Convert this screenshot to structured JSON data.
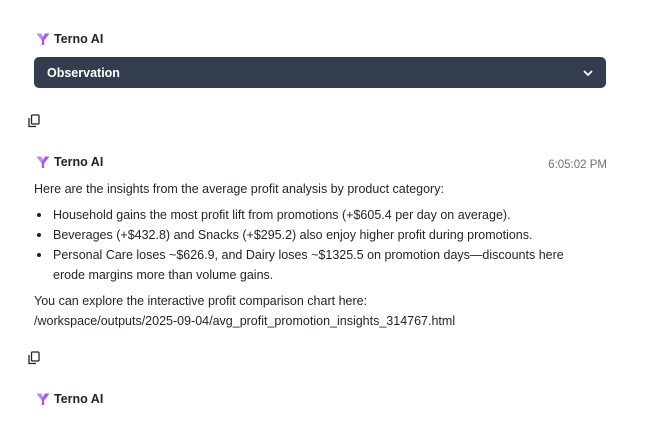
{
  "agent": {
    "name": "Terno AI",
    "logo_icon": "terno-logo-icon",
    "logo_color": "#a855f7"
  },
  "observation": {
    "label": "Observation",
    "icon": "chevron-down-icon"
  },
  "message": {
    "timestamp": "6:05:02 PM",
    "intro": "Here are the insights from the average profit analysis by product category:",
    "bullets": [
      {
        "line1": "Household gains the most profit lift from promotions (+$605.4 per day on average).",
        "line2": ""
      },
      {
        "line1": "Beverages (+$432.8) and Snacks (+$295.2) also enjoy higher profit during promotions.",
        "line2": ""
      },
      {
        "line1": "Personal Care loses ~$626.9, and Dairy loses ~$1325.5 on promotion days—discounts here",
        "line2": "erode margins more than volume gains."
      }
    ],
    "outro_line1": "You can explore the interactive profit comparison chart here:",
    "outro_line2": "/workspace/outputs/2025-09-04/avg_profit_promotion_insights_314767.html"
  },
  "copy_icon": "copy-icon",
  "colors": {
    "observation_bg": "#343d4e",
    "text": "#1f2328",
    "muted": "#6b7280"
  }
}
